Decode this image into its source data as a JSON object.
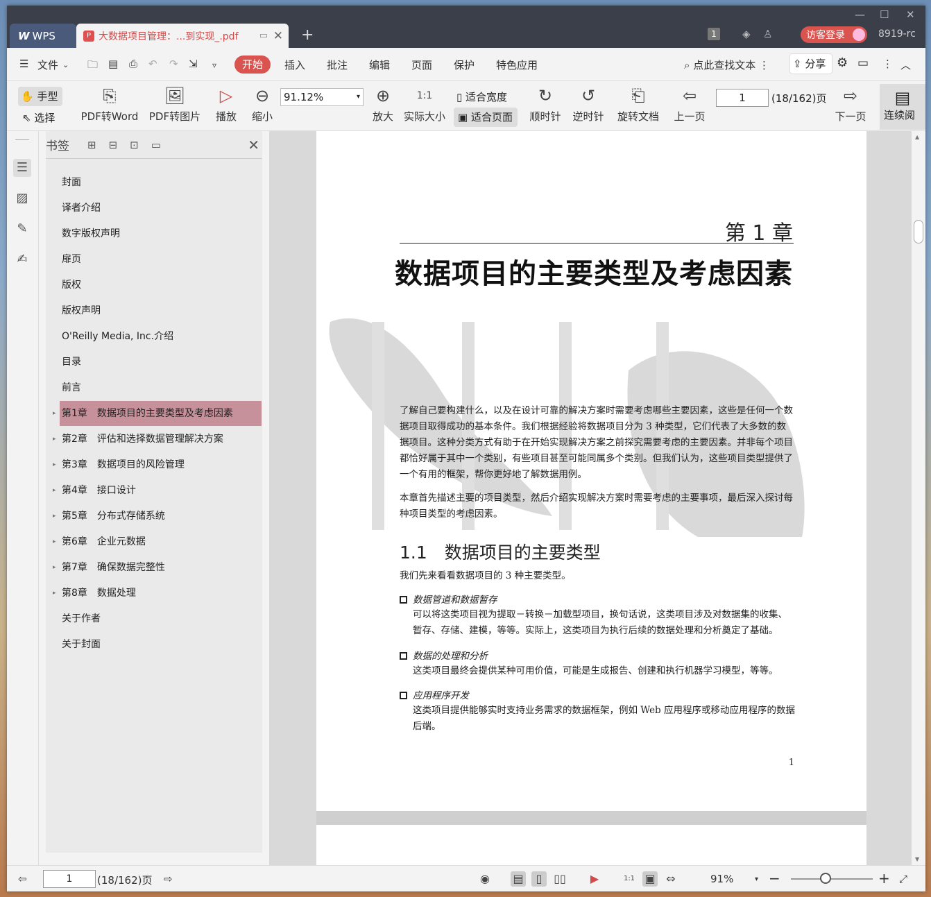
{
  "app": {
    "name": "WPS",
    "user_id": "8919-rc",
    "login_label": "访客登录",
    "badge": "1"
  },
  "tab": {
    "title": "大数据项目管理：...到实现_.pdf"
  },
  "menu": {
    "file": "文件",
    "items": [
      "开始",
      "插入",
      "批注",
      "编辑",
      "页面",
      "保护",
      "特色应用"
    ],
    "search": "点此查找文本",
    "share": "分享"
  },
  "toolbar": {
    "hand": "手型",
    "select": "选择",
    "pdf_to_word": "PDF转Word",
    "pdf_to_image": "PDF转图片",
    "play": "播放",
    "zoom_out": "缩小",
    "zoom_value": "91.12%",
    "zoom_in": "放大",
    "actual_size": "实际大小",
    "fit_width": "适合宽度",
    "fit_page": "适合页面",
    "clockwise": "顺时针",
    "counterclockwise": "逆时针",
    "rotate_doc": "旋转文档",
    "prev_page": "上一页",
    "page_value": "1",
    "page_count": "(18/162)页",
    "next_page": "下一页",
    "continuous": "连续阅"
  },
  "bookmarks": {
    "title": "书签",
    "items": [
      {
        "label": "封面",
        "expandable": false
      },
      {
        "label": "译者介绍",
        "expandable": false
      },
      {
        "label": "数字版权声明",
        "expandable": false
      },
      {
        "label": "扉页",
        "expandable": false
      },
      {
        "label": "版权",
        "expandable": false
      },
      {
        "label": "版权声明",
        "expandable": false
      },
      {
        "label": "O'Reilly Media, Inc.介绍",
        "expandable": false
      },
      {
        "label": "目录",
        "expandable": false
      },
      {
        "label": "前言",
        "expandable": false
      },
      {
        "label": "第1章　数据项目的主要类型及考虑因素",
        "expandable": true,
        "active": true
      },
      {
        "label": "第2章　评估和选择数据管理解决方案",
        "expandable": true
      },
      {
        "label": "第3章　数据项目的风险管理",
        "expandable": true
      },
      {
        "label": "第4章　接口设计",
        "expandable": true
      },
      {
        "label": "第5章　分布式存储系统",
        "expandable": true
      },
      {
        "label": "第6章　企业元数据",
        "expandable": true
      },
      {
        "label": "第7章　确保数据完整性",
        "expandable": true
      },
      {
        "label": "第8章　数据处理",
        "expandable": true
      },
      {
        "label": "关于作者",
        "expandable": false
      },
      {
        "label": "关于封面",
        "expandable": false
      }
    ]
  },
  "document": {
    "chapter": "第 1 章",
    "chapter_title": "数据项目的主要类型及考虑因素",
    "intro1": "了解自己要构建什么，以及在设计可靠的解决方案时需要考虑哪些主要因素，这些是任何一个数据项目取得成功的基本条件。我们根据经验将数据项目分为 3 种类型，它们代表了大多数的数据项目。这种分类方式有助于在开始实现解决方案之前探究需要考虑的主要因素。并非每个项目都恰好属于其中一个类别，有些项目甚至可能同属多个类别。但我们认为，这些项目类型提供了一个有用的框架，帮你更好地了解数据用例。",
    "intro2": "本章首先描述主要的项目类型，然后介绍实现解决方案时需要考虑的主要事项，最后深入探讨每种项目类型的考虑因素。",
    "section": "1.1　数据项目的主要类型",
    "section_intro": "我们先来看看数据项目的 3 种主要类型。",
    "bullets": [
      {
        "title": "数据管道和数据暂存",
        "text": "可以将这类项目视为提取－转换－加载型项目，换句话说，这类项目涉及对数据集的收集、暂存、存储、建模，等等。实际上，这类项目为执行后续的数据处理和分析奠定了基础。"
      },
      {
        "title": "数据的处理和分析",
        "text": "这类项目最终会提供某种可用价值，可能是生成报告、创建和执行机器学习模型，等等。"
      },
      {
        "title": "应用程序开发",
        "text": "这类项目提供能够实时支持业务需求的数据框架，例如 Web 应用程序或移动应用程序的数据后端。"
      }
    ],
    "page_number": "1"
  },
  "status": {
    "page_value": "1",
    "page_count": "(18/162)页",
    "zoom": "91%"
  }
}
